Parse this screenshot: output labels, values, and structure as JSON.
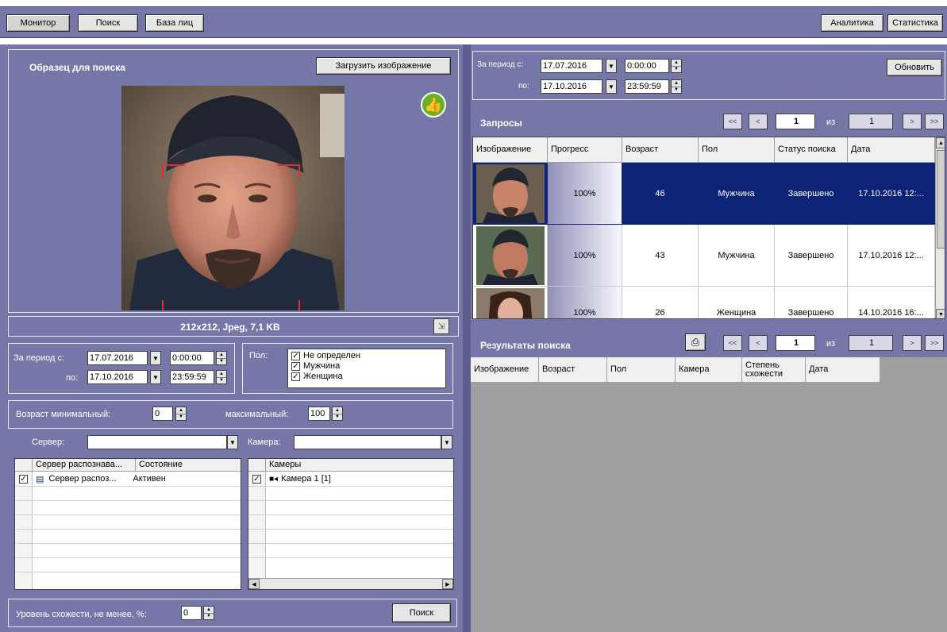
{
  "top_nav": {
    "monitor": "Монитор",
    "search": "Поиск",
    "face_db": "База лиц",
    "analytics": "Аналитика",
    "statistics": "Статистика"
  },
  "sample": {
    "title": "Образец для поиска",
    "load_button": "Загрузить изображение",
    "image_info": "212x212, Jpeg, 7,1 KB"
  },
  "left_period": {
    "from_label": "За период с:",
    "to_label": "по:",
    "from_date": "17.07.2016",
    "from_time": "0:00:00",
    "to_date": "17.10.2016",
    "to_time": "23:59:59"
  },
  "gender": {
    "label": "Пол:",
    "options": [
      "Не определен",
      "Мужчина",
      "Женщина"
    ]
  },
  "age": {
    "min_label": "Возраст минимальный:",
    "min_value": "0",
    "max_label": "максимальный:",
    "max_value": "100"
  },
  "server": {
    "label": "Сервер:",
    "value": "",
    "camera_label": "Камера:",
    "camera_value": ""
  },
  "servers_table": {
    "columns": [
      "Сервер распознава...",
      "Состояние"
    ],
    "rows": [
      {
        "name": "Сервер распоз...",
        "state": "Активен"
      }
    ]
  },
  "cameras_table": {
    "columns": [
      "Камеры"
    ],
    "rows": [
      {
        "name": "Камера 1 [1]"
      }
    ]
  },
  "similarity": {
    "label": "Уровень схожести, не менее, %:",
    "value": "0",
    "search_button": "Поиск"
  },
  "right_period": {
    "from_label": "За период с:",
    "to_label": "по:",
    "from_date": "17.07.2016",
    "from_time": "0:00:00",
    "to_date": "17.10.2016",
    "to_time": "23:59:59",
    "refresh_button": "Обновить"
  },
  "requests": {
    "title": "Запросы",
    "page": "1",
    "of_label": "из",
    "total": "1",
    "columns": [
      "Изображение",
      "Прогресс",
      "Возраст",
      "Пол",
      "Статус поиска",
      "Дата"
    ],
    "rows": [
      {
        "progress": "100%",
        "age": "46",
        "gender": "Мужчина",
        "status": "Завершено",
        "date": "17.10.2016 12:..."
      },
      {
        "progress": "100%",
        "age": "43",
        "gender": "Мужчина",
        "status": "Завершено",
        "date": "17.10.2016 12:..."
      },
      {
        "progress": "100%",
        "age": "26",
        "gender": "Женщина",
        "status": "Завершено",
        "date": "14.10.2016 16:..."
      }
    ]
  },
  "results": {
    "title": "Результаты поиска",
    "page": "1",
    "of_label": "из",
    "total": "1",
    "columns": [
      "Изображение",
      "Возраст",
      "Пол",
      "Камера",
      "Степень схожести",
      "Дата"
    ]
  },
  "nav_glyphs": {
    "first": "<<",
    "prev": "<",
    "next": ">",
    "last": ">>"
  },
  "colors": {
    "panel": "#7577a8",
    "selected_row": "#0c2478",
    "face_frame": "#e03030",
    "thumb_badge": "#6ab023"
  }
}
